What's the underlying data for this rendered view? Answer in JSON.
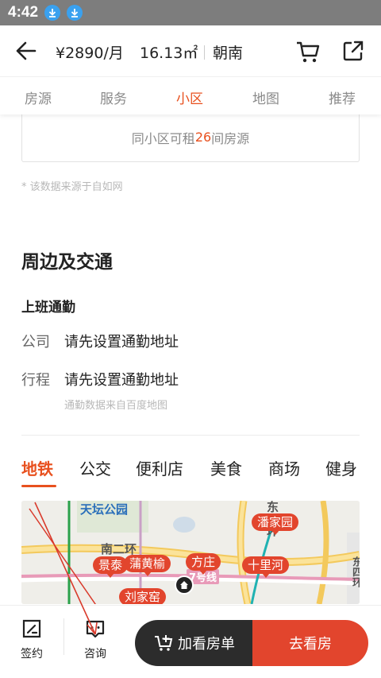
{
  "status_bar": {
    "time": "4:42",
    "icons": [
      "download-icon",
      "download-icon"
    ]
  },
  "header": {
    "price": "¥2890/月",
    "area": "16.13㎡",
    "orientation": "朝南",
    "icons": [
      "back-arrow-icon",
      "cart-icon",
      "share-icon"
    ]
  },
  "tabs": [
    {
      "label": "房源",
      "active": false
    },
    {
      "label": "服务",
      "active": false
    },
    {
      "label": "小区",
      "active": true
    },
    {
      "label": "地图",
      "active": false
    },
    {
      "label": "推荐",
      "active": false
    }
  ],
  "rentable": {
    "prefix": "同小区可租",
    "count": "26",
    "suffix": "间房源"
  },
  "source_note": "* 该数据来源于自如网",
  "surroundings": {
    "title": "周边及交通",
    "commute_title": "上班通勤",
    "rows": [
      {
        "label": "公司",
        "value": "请先设置通勤地址"
      },
      {
        "label": "行程",
        "value": "请先设置通勤地址"
      }
    ],
    "commute_note": "通勤数据来自百度地图"
  },
  "categories": [
    {
      "label": "地铁",
      "active": true
    },
    {
      "label": "公交",
      "active": false
    },
    {
      "label": "便利店",
      "active": false
    },
    {
      "label": "美食",
      "active": false
    },
    {
      "label": "商场",
      "active": false
    },
    {
      "label": "健身",
      "active": false
    }
  ],
  "map": {
    "labels": [
      "天坛公园",
      "南二环",
      "东二环",
      "东四环",
      "7号线"
    ],
    "stations": [
      "潘家园",
      "景泰",
      "蒲黄榆",
      "方庄",
      "十里河",
      "刘家窑"
    ]
  },
  "bottom_bar": {
    "sign_label": "签约",
    "consult_label": "咨询",
    "add_label": "加看房单",
    "go_label": "去看房"
  },
  "colors": {
    "accent": "#e8501e",
    "dark_button": "#2c2c2c",
    "pin": "#e2452d",
    "status_bar": "#7d7d7d"
  }
}
